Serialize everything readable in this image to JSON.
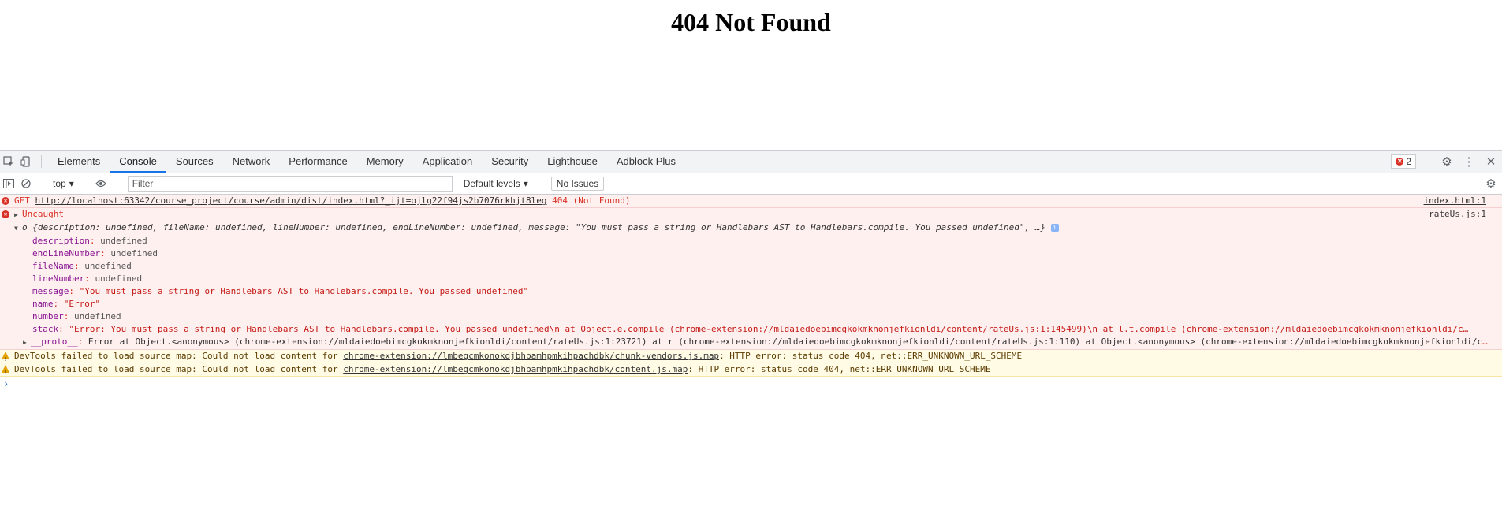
{
  "page": {
    "heading": "404 Not Found"
  },
  "devtools": {
    "tabs": [
      "Elements",
      "Console",
      "Sources",
      "Network",
      "Performance",
      "Memory",
      "Application",
      "Security",
      "Lighthouse",
      "Adblock Plus"
    ],
    "active_tab": "Console",
    "error_count": "2",
    "toolbar": {
      "context": "top",
      "filter_placeholder": "Filter",
      "levels": "Default levels",
      "issues": "No Issues"
    }
  },
  "console": {
    "get_error": {
      "method": "GET",
      "url": "http://localhost:63342/course_project/course/admin/dist/index.html?_ijt=ojlg22f94js2b7076rkhjt8leg",
      "status": "404 (Not Found)",
      "source": "index.html:1"
    },
    "uncaught": {
      "label": "Uncaught",
      "source": "rateUs.js:1",
      "summary_prefix": "o",
      "summary": "{description: undefined, fileName: undefined, lineNumber: undefined, endLineNumber: undefined, message: \"You must pass a string or Handlebars AST to Handlebars.compile. You passed undefined\", …}",
      "props": [
        {
          "key": "description",
          "value": "undefined",
          "kind": "undef"
        },
        {
          "key": "endLineNumber",
          "value": "undefined",
          "kind": "undef"
        },
        {
          "key": "fileName",
          "value": "undefined",
          "kind": "undef"
        },
        {
          "key": "lineNumber",
          "value": "undefined",
          "kind": "undef"
        },
        {
          "key": "message",
          "value": "\"You must pass a string or Handlebars AST to Handlebars.compile. You passed undefined\"",
          "kind": "str"
        },
        {
          "key": "name",
          "value": "\"Error\"",
          "kind": "str"
        },
        {
          "key": "number",
          "value": "undefined",
          "kind": "undef"
        },
        {
          "key": "stack",
          "value": "\"Error: You must pass a string or Handlebars AST to Handlebars.compile. You passed undefined\\n    at Object.e.compile (chrome-extension://mldaiedoebimcgkokmknonjefkionldi/content/rateUs.js:1:145499)\\n    at l.t.compile (chrome-extension://mldaiedoebimcgkokmknonjefkionldi/c…",
          "kind": "str"
        }
      ],
      "proto": {
        "key": "__proto__",
        "value": "Error at Object.<anonymous> (chrome-extension://mldaiedoebimcgkokmknonjefkionldi/content/rateUs.js:1:23721) at r (chrome-extension://mldaiedoebimcgkokmknonjefkionldi/content/rateUs.js:1:110) at Object.<anonymous> (chrome-extension://mldaiedoebimcgkokmknonjefkionldi/co…"
      }
    },
    "warnings": [
      {
        "prefix": "DevTools failed to load source map: Could not load content for",
        "url": "chrome-extension://lmbegcmkonokdjbhbamhpmkihpachdbk/chunk-vendors.js.map",
        "suffix": ": HTTP error: status code 404, net::ERR_UNKNOWN_URL_SCHEME"
      },
      {
        "prefix": "DevTools failed to load source map: Could not load content for",
        "url": "chrome-extension://lmbegcmkonokdjbhbamhpmkihpachdbk/content.js.map",
        "suffix": ": HTTP error: status code 404, net::ERR_UNKNOWN_URL_SCHEME"
      }
    ],
    "prompt": "›"
  }
}
